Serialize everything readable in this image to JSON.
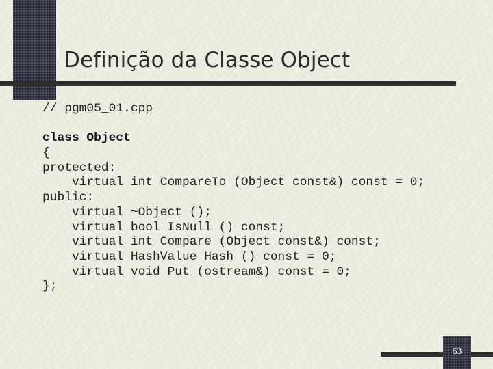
{
  "slide": {
    "title": "Definição da Classe Object",
    "page_number": "63",
    "colors": {
      "background": "#ebebdf",
      "accent_block": "#3b3d4b",
      "rule": "#2e2e2c",
      "text": "#222222"
    }
  },
  "code": {
    "lines": [
      {
        "text": "// pgm05_01.cpp",
        "bold": false
      },
      {
        "text": "",
        "bold": false
      },
      {
        "text": "class Object",
        "bold": true
      },
      {
        "text": "{",
        "bold": false
      },
      {
        "text": "protected:",
        "bold": false
      },
      {
        "text": "    virtual int CompareTo (Object const&) const = 0;",
        "bold": false
      },
      {
        "text": "public:",
        "bold": false
      },
      {
        "text": "    virtual ~Object ();",
        "bold": false
      },
      {
        "text": "    virtual bool IsNull () const;",
        "bold": false
      },
      {
        "text": "    virtual int Compare (Object const&) const;",
        "bold": false
      },
      {
        "text": "    virtual HashValue Hash () const = 0;",
        "bold": false
      },
      {
        "text": "    virtual void Put (ostream&) const = 0;",
        "bold": false
      },
      {
        "text": "};",
        "bold": false
      }
    ]
  }
}
